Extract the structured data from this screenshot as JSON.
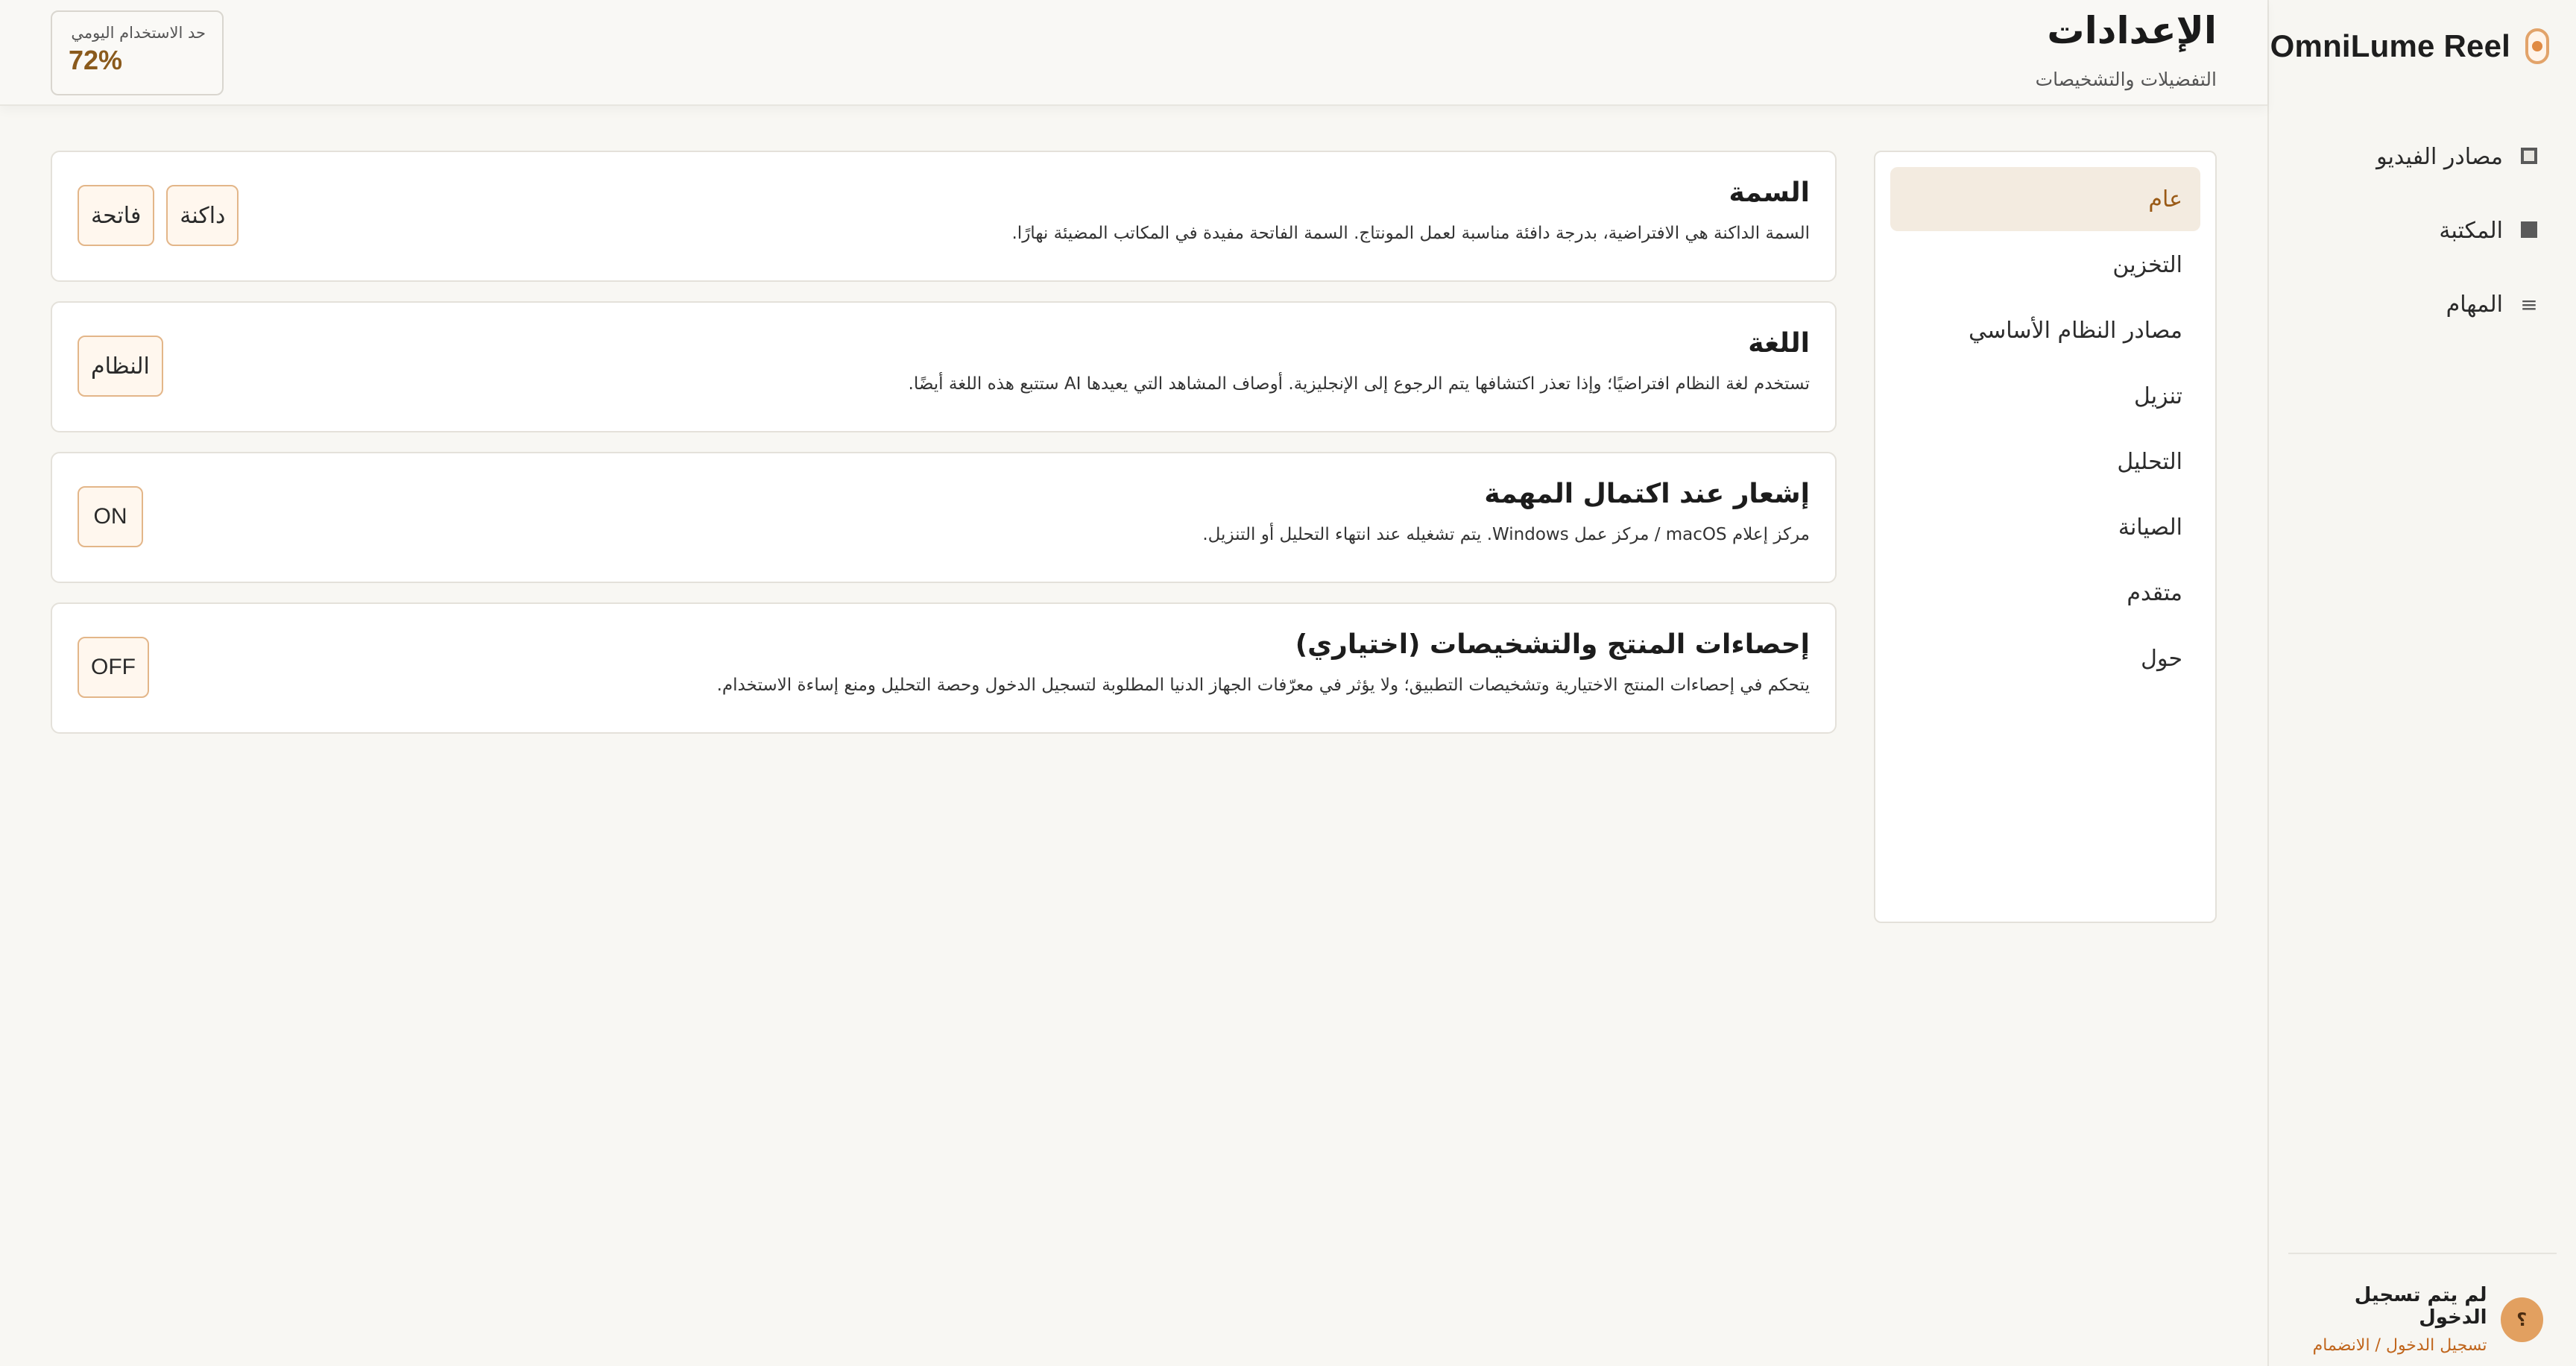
{
  "brand": {
    "name": "OmniLume Reel",
    "logo_icon": "omnilume-logo-icon",
    "accent": "#e08a43"
  },
  "sidebar": {
    "items": [
      {
        "label": "مصادر الفيديو",
        "icon": "video-source-icon"
      },
      {
        "label": "المكتبة",
        "icon": "library-icon"
      },
      {
        "label": "المهام",
        "icon": "tasks-icon"
      }
    ]
  },
  "user": {
    "avatar_text": "؟",
    "status": "لم يتم تسجيل الدخول",
    "link": "تسجيل الدخول / الانضمام"
  },
  "header": {
    "title": "الإعدادات",
    "subtitle": "التفضيلات والتشخيصات",
    "usage_label": "حد الاستخدام اليومي",
    "usage_value": "72%",
    "usage_percent": 72
  },
  "settings_nav": {
    "active_index": 0,
    "tabs": [
      {
        "label": "عام"
      },
      {
        "label": "التخزين"
      },
      {
        "label": "مصادر النظام الأساسي"
      },
      {
        "label": "تنزيل"
      },
      {
        "label": "التحليل"
      },
      {
        "label": "الصيانة"
      },
      {
        "label": "متقدم"
      },
      {
        "label": "حول"
      }
    ]
  },
  "cards": {
    "theme": {
      "title": "السمة",
      "desc": "السمة الداكنة هي الافتراضية، بدرجة دافئة مناسبة لعمل المونتاج. السمة الفاتحة مفيدة في المكاتب المضيئة نهارًا.",
      "dark_label": "داكنة",
      "light_label": "فاتحة"
    },
    "language": {
      "title": "اللغة",
      "desc": "تستخدم لغة النظام افتراضيًا؛ وإذا تعذر اكتشافها يتم الرجوع إلى الإنجليزية. أوصاف المشاهد التي يعيدها AI ستتبع هذه اللغة أيضًا.",
      "value": "النظام"
    },
    "notify": {
      "title": "إشعار عند اكتمال المهمة",
      "desc": "مركز إعلام macOS / مركز عمل Windows. يتم تشغيله عند انتهاء التحليل أو التنزيل.",
      "value": "ON"
    },
    "telemetry": {
      "title": "إحصاءات المنتج والتشخيصات (اختياري)",
      "desc": "يتحكم في إحصاءات المنتج الاختيارية وتشخيصات التطبيق؛ ولا يؤثر في معرّفات الجهاز الدنيا المطلوبة لتسجيل الدخول وحصة التحليل ومنع إساءة الاستخدام.",
      "value": "OFF"
    }
  }
}
